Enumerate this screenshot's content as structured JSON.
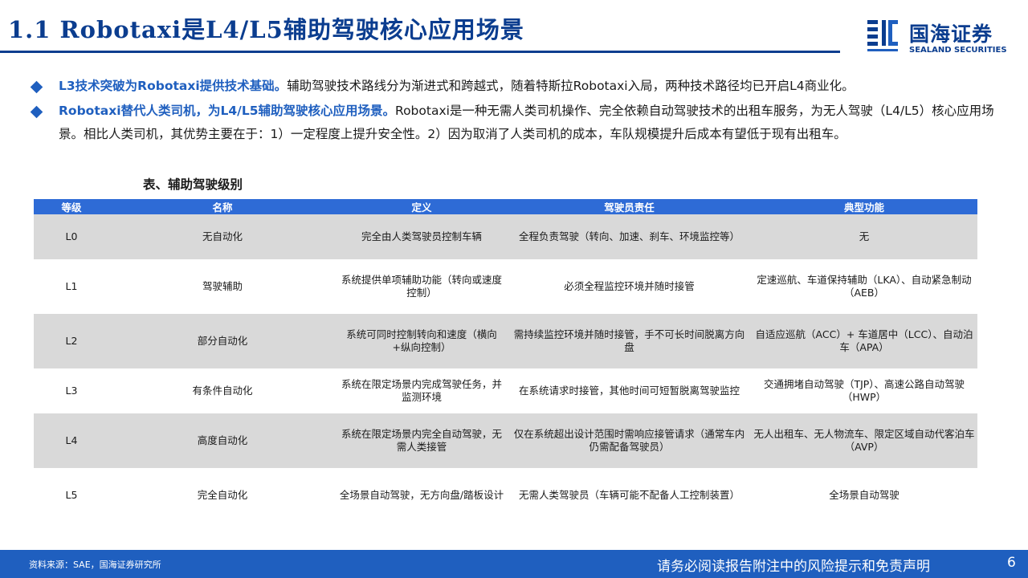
{
  "header": {
    "title": "1.1 Robotaxi是L4/L5辅助驾驶核心应用场景",
    "logo_cn": "国海证券",
    "logo_en": "SEALAND SECURITIES"
  },
  "bullets": [
    {
      "lead": "L3技术突破为Robotaxi提供技术基础。",
      "text": "辅助驾驶技术路线分为渐进式和跨越式，随着特斯拉Robotaxi入局，两种技术路径均已开启L4商业化。"
    },
    {
      "lead": "Robotaxi替代人类司机，为L4/L5辅助驾驶核心应用场景。",
      "text": "Robotaxi是一种无需人类司机操作、完全依赖自动驾驶技术的出租车服务，为无人驾驶（L4/L5）核心应用场景。相比人类司机，其优势主要在于：1）一定程度上提升安全性。2）因为取消了人类司机的成本，车队规模提升后成本有望低于现有出租车。"
    }
  ],
  "table": {
    "caption": "表、辅助驾驶级别",
    "headers": [
      "等级",
      "名称",
      "定义",
      "驾驶员责任",
      "典型功能"
    ],
    "rows": [
      [
        "L0",
        "无自动化",
        "完全由人类驾驶员控制车辆",
        "全程负责驾驶（转向、加速、刹车、环境监控等）",
        "无"
      ],
      [
        "L1",
        "驾驶辅助",
        "系统提供单项辅助功能（转向或速度控制）",
        "必须全程监控环境并随时接管",
        "定速巡航、车道保持辅助（LKA）、自动紧急制动（AEB）"
      ],
      [
        "L2",
        "部分自动化",
        "系统可同时控制转向和速度（横向+纵向控制）",
        "需持续监控环境并随时接管，手不可长时间脱离方向盘",
        "自适应巡航（ACC）+ 车道居中（LCC）、自动泊车（APA）"
      ],
      [
        "L3",
        "有条件自动化",
        "系统在限定场景内完成驾驶任务，并监测环境",
        "在系统请求时接管，其他时间可短暂脱离驾驶监控",
        "交通拥堵自动驾驶（TJP）、高速公路自动驾驶（HWP）"
      ],
      [
        "L4",
        "高度自动化",
        "系统在限定场景内完全自动驾驶，无需人类接管",
        "仅在系统超出设计范围时需响应接管请求（通常车内仍需配备驾驶员）",
        "无人出租车、无人物流车、限定区域自动代客泊车（AVP）"
      ],
      [
        "L5",
        "完全自动化",
        "全场景自动驾驶，无方向盘/踏板设计",
        "无需人类驾驶员（车辆可能不配备人工控制装置）",
        "全场景自动驾驶"
      ]
    ]
  },
  "footer": {
    "source": "资料来源：SAE，国海证券研究所",
    "disclaimer": "请务必阅读报告附注中的风险提示和免责声明",
    "page": "6"
  },
  "colors": {
    "brand": "#0b3d8f",
    "accent": "#1f5fbf",
    "table_header": "#2e6bd6",
    "row_alt": "#d9d9d9"
  }
}
